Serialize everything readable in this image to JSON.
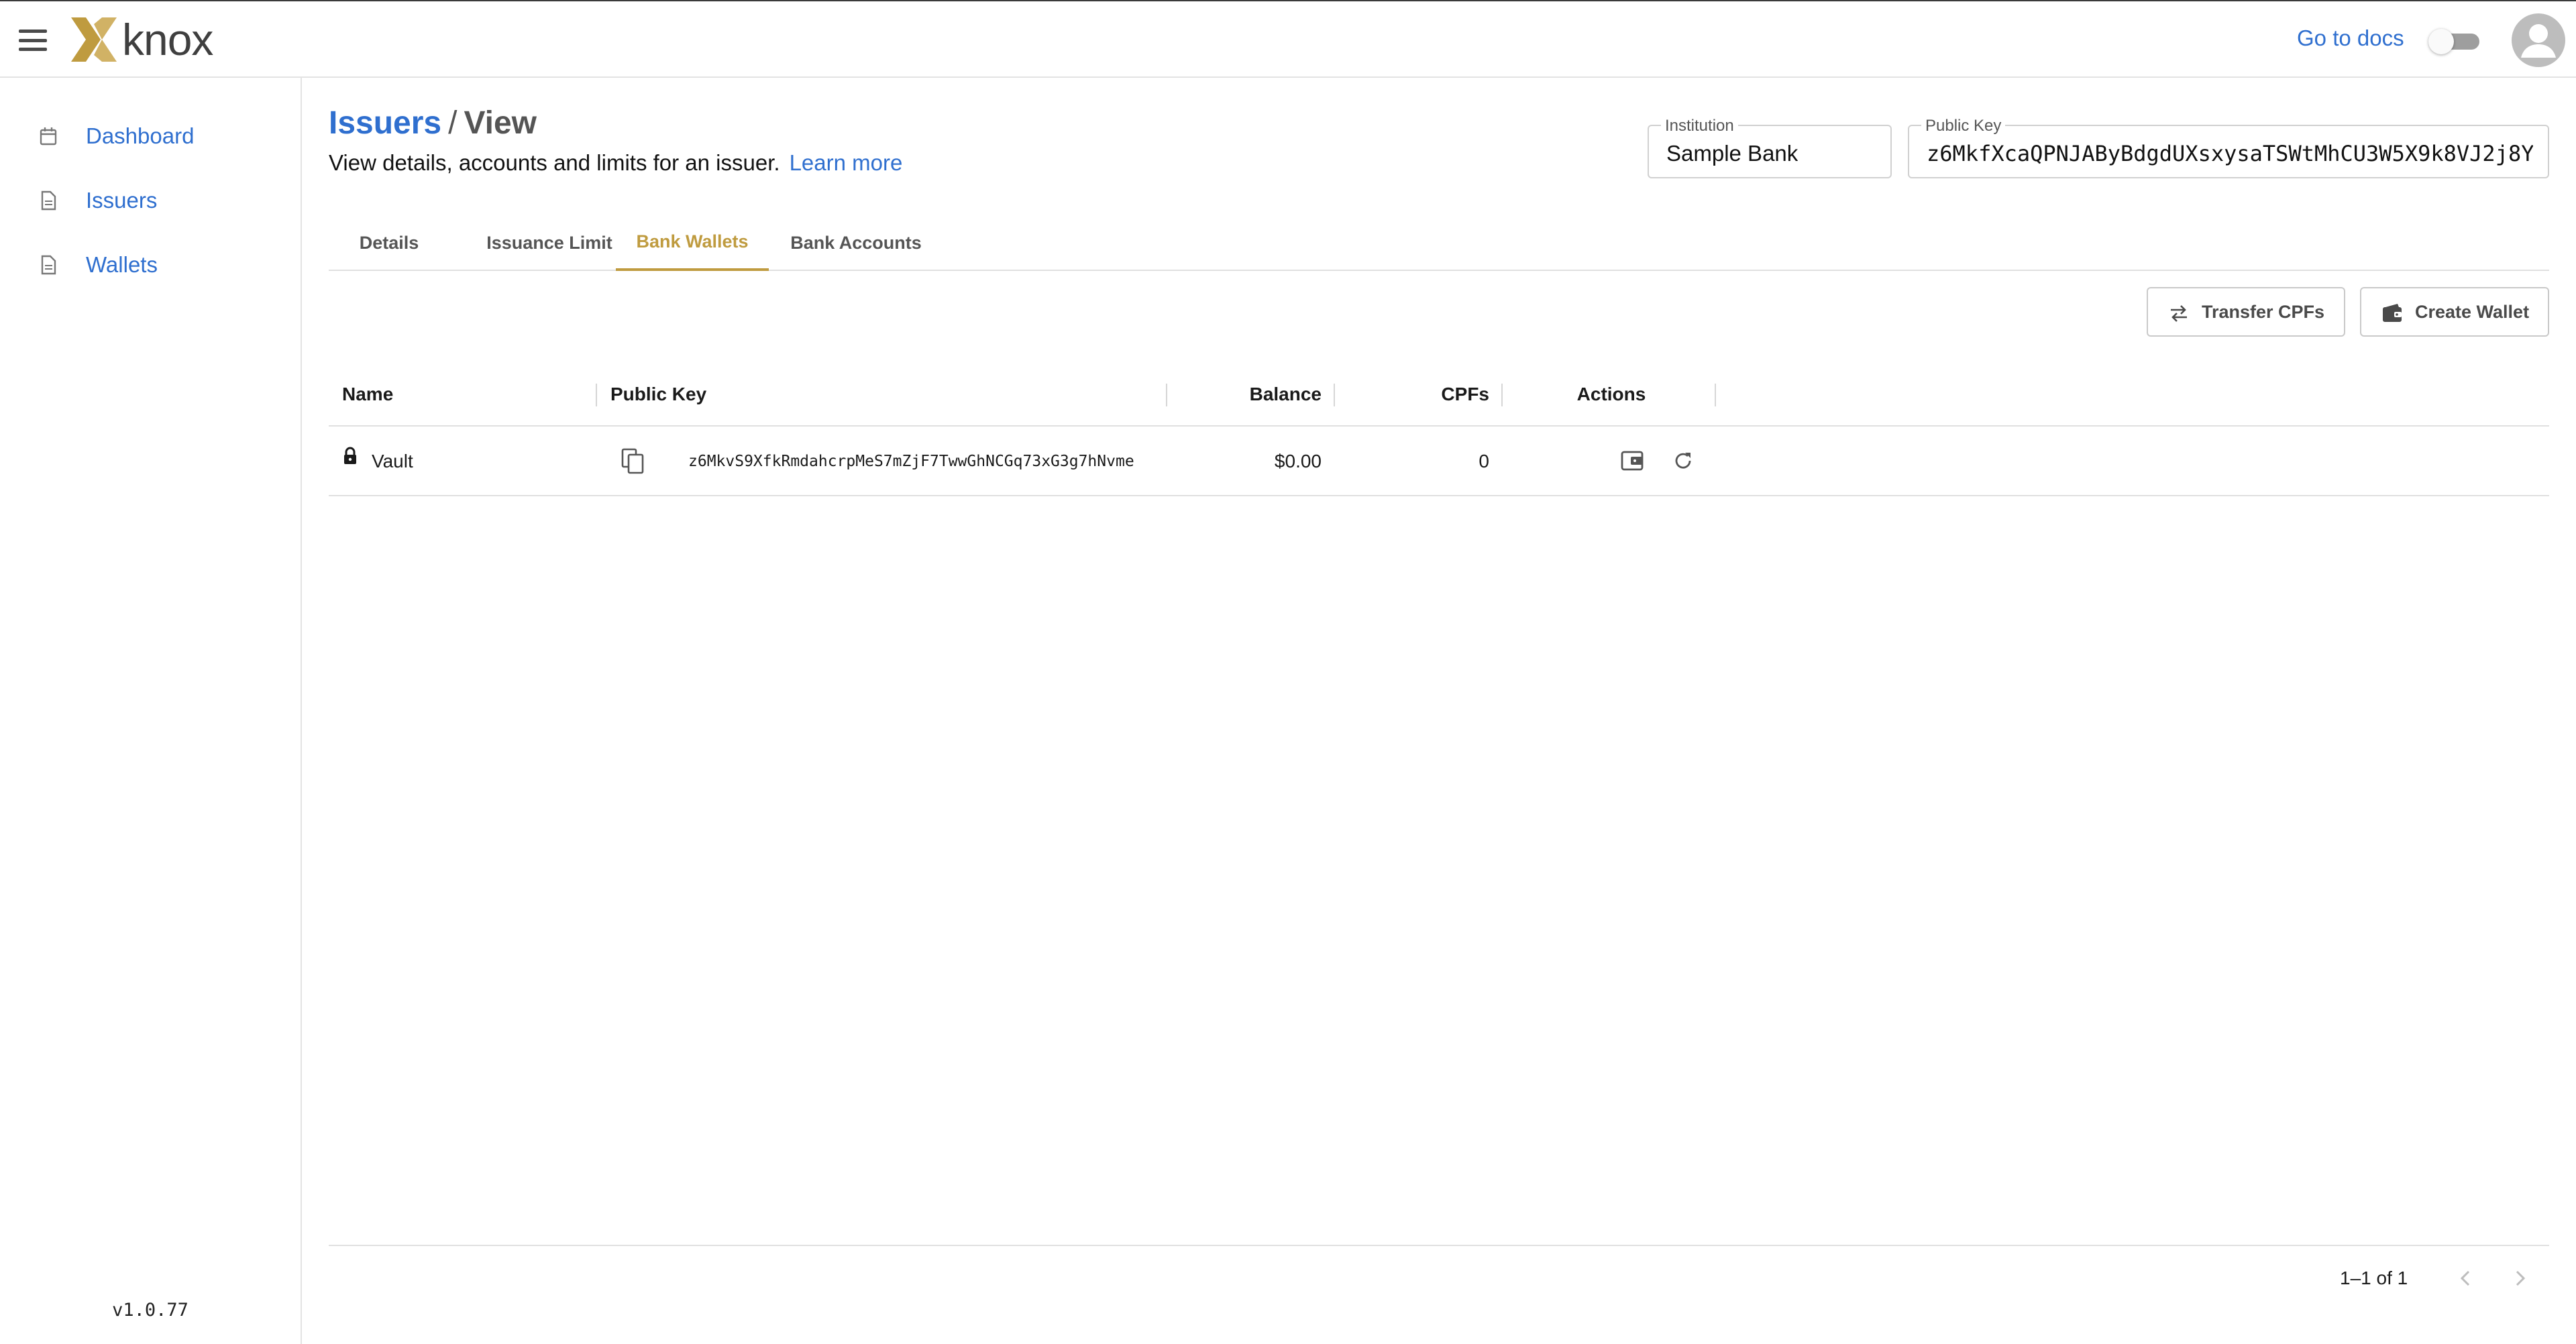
{
  "topbar": {
    "logo_text": "knox",
    "docs_link": "Go to docs"
  },
  "sidebar": {
    "items": [
      {
        "label": "Dashboard",
        "icon": "calendar-icon"
      },
      {
        "label": "Issuers",
        "icon": "document-icon"
      },
      {
        "label": "Wallets",
        "icon": "document-icon"
      }
    ],
    "version": "v1.0.77"
  },
  "header": {
    "crumb_parent": "Issuers",
    "crumb_separator": "/",
    "crumb_current": "View",
    "subtitle": "View details, accounts and limits for an issuer.",
    "learn_more": "Learn more"
  },
  "fields": {
    "institution": {
      "label": "Institution",
      "value": "Sample Bank"
    },
    "public_key": {
      "label": "Public Key",
      "value": "z6MkfXcaQPNJAByBdgdUXsxysaTSWtMhCU3W5X9k8VJ2j8Y"
    }
  },
  "tabs": [
    {
      "label": "Details",
      "active": false
    },
    {
      "label": "Issuance Limit",
      "active": false
    },
    {
      "label": "Bank Wallets",
      "active": true
    },
    {
      "label": "Bank Accounts",
      "active": false
    }
  ],
  "actions": {
    "transfer_label": "Transfer CPFs",
    "create_label": "Create Wallet"
  },
  "table": {
    "columns": [
      "Name",
      "Public Key",
      "Balance",
      "CPFs",
      "Actions"
    ],
    "rows": [
      {
        "name": "Vault",
        "public_key": "z6MkvS9XfkRmdahcrpMeS7mZjF7TwwGhNCGq73xG3g7hNvme",
        "balance": "$0.00",
        "cpfs": "0"
      }
    ],
    "pagination": "1–1 of 1"
  },
  "colors": {
    "accent_gold": "#bf9b3f",
    "link_blue": "#2f6fcf"
  }
}
